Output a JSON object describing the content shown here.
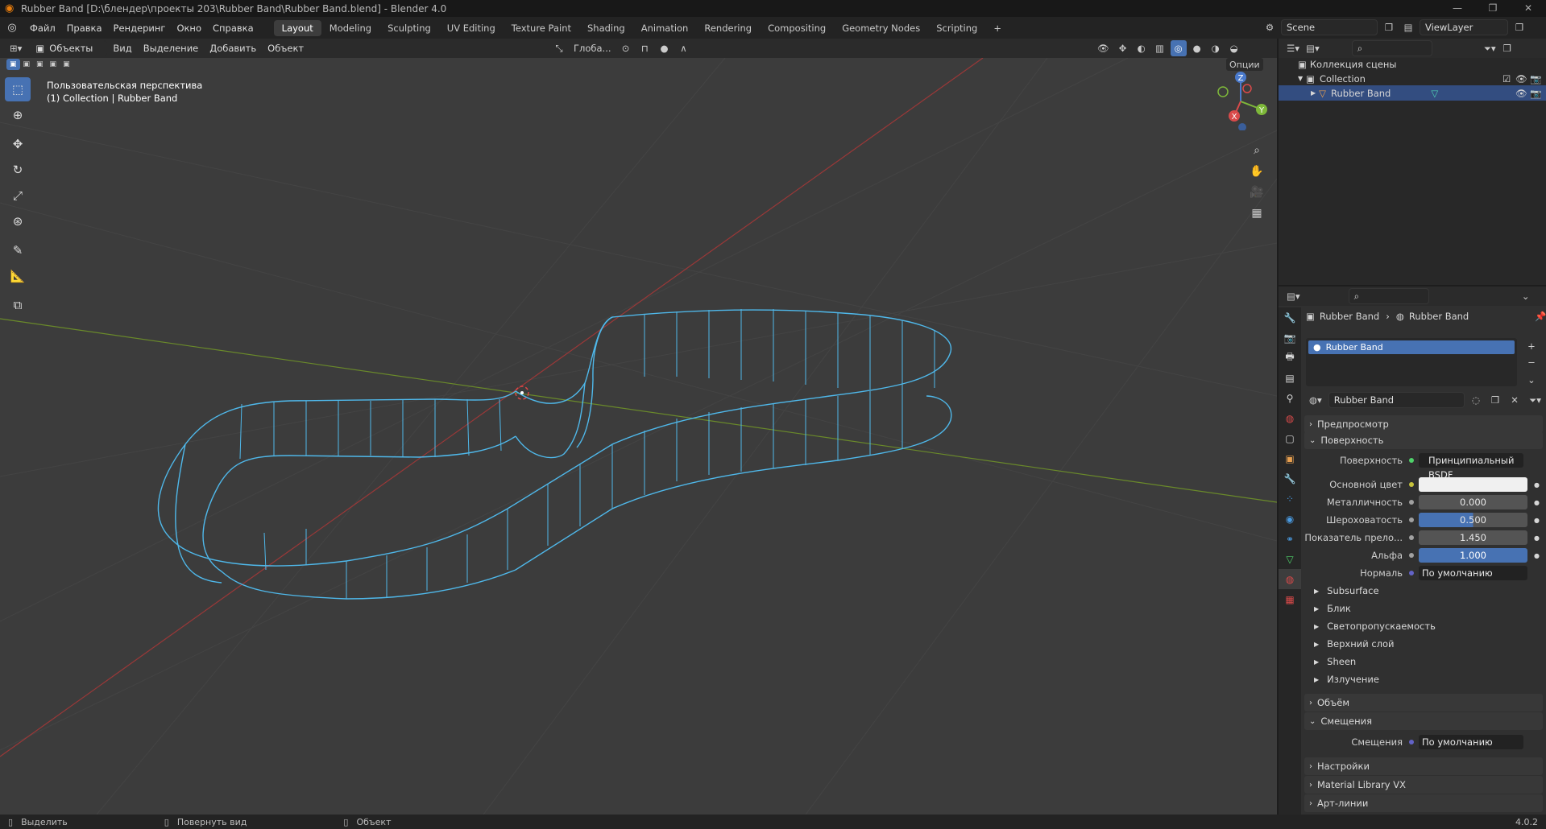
{
  "window": {
    "title": "Rubber Band [D:\\блендер\\проекты 203\\Rubber Band\\Rubber Band.blend] - Blender 4.0",
    "minimize": "—",
    "restore": "❐",
    "close": "✕"
  },
  "menu": {
    "items": [
      "Файл",
      "Правка",
      "Рендеринг",
      "Окно",
      "Справка"
    ],
    "workspaces": [
      "Layout",
      "Modeling",
      "Sculpting",
      "UV Editing",
      "Texture Paint",
      "Shading",
      "Animation",
      "Rendering",
      "Compositing",
      "Geometry Nodes",
      "Scripting"
    ],
    "active_workspace": "Layout",
    "add_workspace": "+",
    "scene": "Scene",
    "view_layer": "ViewLayer"
  },
  "viewport_header": {
    "mode": "Объекты",
    "menus": [
      "Вид",
      "Выделение",
      "Добавить",
      "Объект"
    ],
    "transform_orientation": "Глоба...",
    "options": "Опции"
  },
  "viewport": {
    "view_name": "Пользовательская перспектива",
    "collection_info": "(1) Collection | Rubber Band",
    "gizmo": {
      "x": "X",
      "y": "Y",
      "z": "Z"
    }
  },
  "outliner": {
    "root": "Коллекция сцены",
    "collection": "Collection",
    "object": "Rubber Band"
  },
  "properties": {
    "breadcrumb_object": "Rubber Band",
    "breadcrumb_material": "Rubber Band",
    "slot_name": "Rubber Band",
    "material_name": "Rubber Band",
    "sections": {
      "preview": "Предпросмотр",
      "surface": "Поверхность",
      "volume": "Объём",
      "displacement": "Смещения",
      "settings": "Настройки",
      "matlib": "Material Library VX",
      "lineart": "Арт-линии"
    },
    "surface_label": "Поверхность",
    "surface_value": "Принципиальный BSDF",
    "params": [
      {
        "label": "Основной цвет",
        "value": "",
        "style": "white"
      },
      {
        "label": "Металличность",
        "value": "0.000",
        "style": "gray"
      },
      {
        "label": "Шероховатость",
        "value": "0.500",
        "style": "blue-half"
      },
      {
        "label": "Показатель прело...",
        "value": "1.450",
        "style": "gray"
      },
      {
        "label": "Альфа",
        "value": "1.000",
        "style": "blue"
      },
      {
        "label": "Нормаль",
        "value": "По умолчанию",
        "style": "dark"
      }
    ],
    "subpanels": [
      "Subsurface",
      "Блик",
      "Светопропускаемость",
      "Верхний слой",
      "Sheen",
      "Излучение"
    ],
    "displacement_label": "Смещения",
    "displacement_value": "По умолчанию"
  },
  "statusbar": {
    "select": "Выделить",
    "rotate": "Повернуть вид",
    "object": "Объект",
    "version": "4.0.2"
  }
}
